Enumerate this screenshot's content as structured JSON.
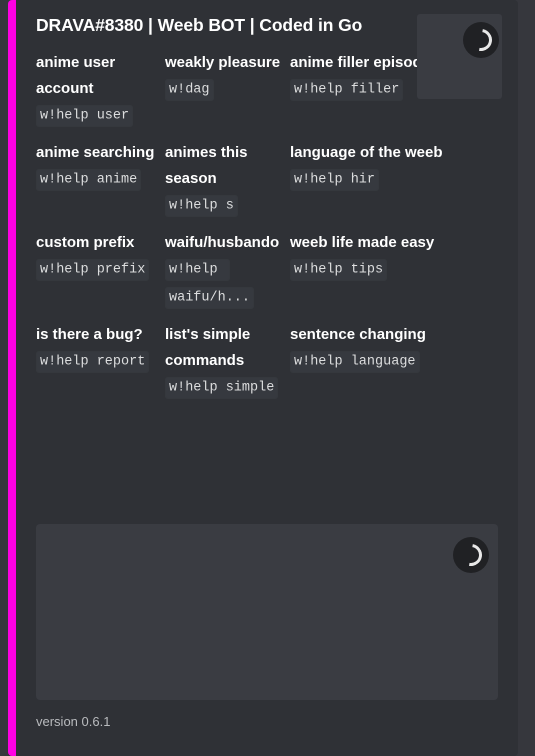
{
  "embed": {
    "accent_color": "#ff00e4",
    "background_color": "#2f3136",
    "title": "DRAVA#8380 | Weeb BOT | Coded in Go",
    "thumbnail": {
      "state": "loading",
      "icon": "loading-spinner-icon"
    },
    "image": {
      "state": "loading",
      "icon": "loading-spinner-icon"
    },
    "footer": {
      "text": "version 0.6.1"
    },
    "fields": [
      {
        "name": "anime user account",
        "value": "w!help user"
      },
      {
        "name": "weakly pleasure",
        "value": "w!dag"
      },
      {
        "name": "anime filler episodes",
        "value": "w!help filler"
      },
      {
        "name": "anime searching",
        "value": "w!help anime"
      },
      {
        "name": "animes this season",
        "value": "w!help s"
      },
      {
        "name": "language of the weeb",
        "value": "w!help hir"
      },
      {
        "name": "custom prefix",
        "value": "w!help prefix"
      },
      {
        "name": "waifu/husbando",
        "value": "w!help waifu/h..."
      },
      {
        "name": "weeb life made easy",
        "value": "w!help tips"
      },
      {
        "name": "is there a bug?",
        "value": "w!help report"
      },
      {
        "name": "list's simple commands",
        "value": "w!help simple"
      },
      {
        "name": "sentence changing",
        "value": "w!help language"
      }
    ]
  }
}
